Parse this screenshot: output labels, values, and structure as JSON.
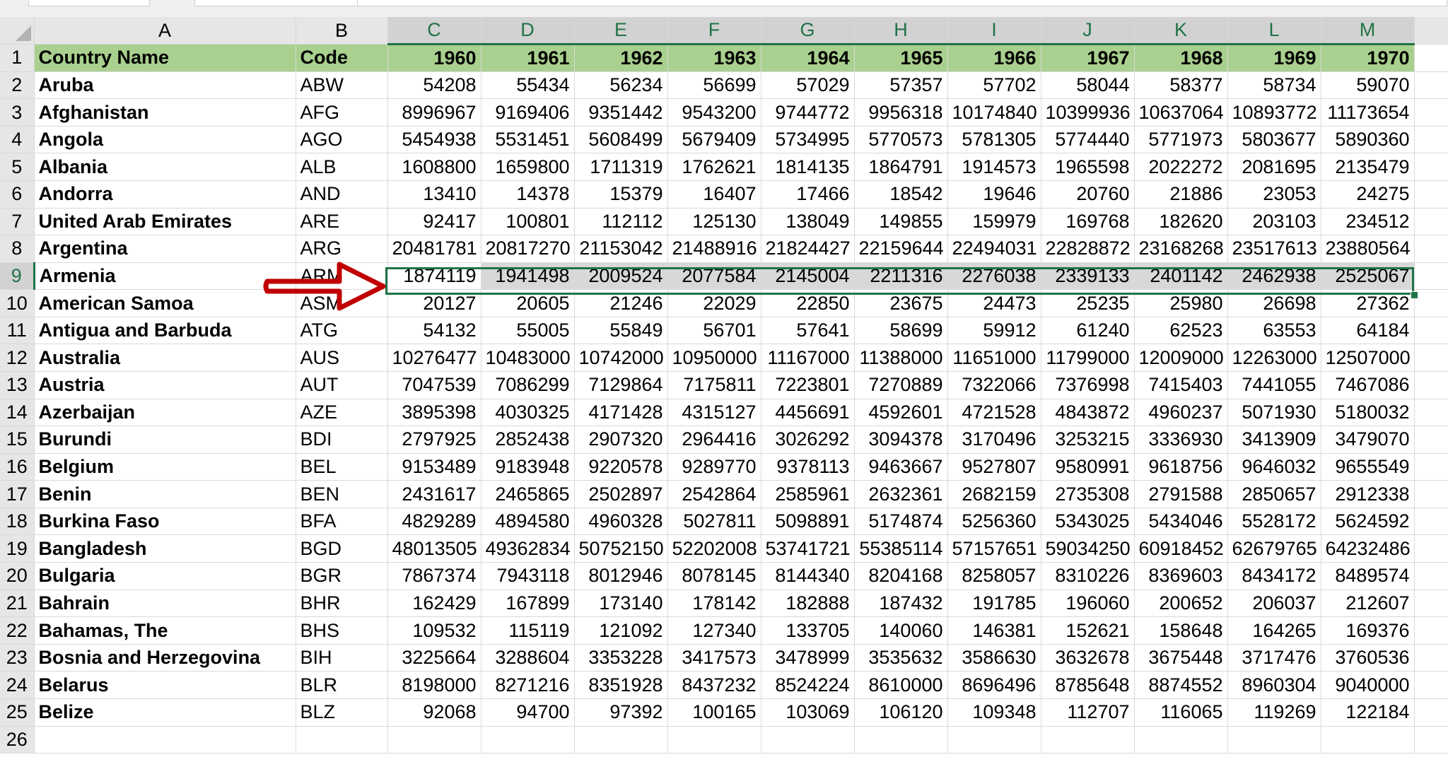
{
  "sheet": {
    "columns": [
      "A",
      "B",
      "C",
      "D",
      "E",
      "F",
      "G",
      "H",
      "I",
      "J",
      "K",
      "L",
      "M"
    ],
    "header": [
      "Country Name",
      "Code",
      "1960",
      "1961",
      "1962",
      "1963",
      "1964",
      "1965",
      "1966",
      "1967",
      "1968",
      "1969",
      "1970"
    ],
    "rows": [
      [
        "Aruba",
        "ABW",
        "54208",
        "55434",
        "56234",
        "56699",
        "57029",
        "57357",
        "57702",
        "58044",
        "58377",
        "58734",
        "59070"
      ],
      [
        "Afghanistan",
        "AFG",
        "8996967",
        "9169406",
        "9351442",
        "9543200",
        "9744772",
        "9956318",
        "10174840",
        "10399936",
        "10637064",
        "10893772",
        "11173654"
      ],
      [
        "Angola",
        "AGO",
        "5454938",
        "5531451",
        "5608499",
        "5679409",
        "5734995",
        "5770573",
        "5781305",
        "5774440",
        "5771973",
        "5803677",
        "5890360"
      ],
      [
        "Albania",
        "ALB",
        "1608800",
        "1659800",
        "1711319",
        "1762621",
        "1814135",
        "1864791",
        "1914573",
        "1965598",
        "2022272",
        "2081695",
        "2135479"
      ],
      [
        "Andorra",
        "AND",
        "13410",
        "14378",
        "15379",
        "16407",
        "17466",
        "18542",
        "19646",
        "20760",
        "21886",
        "23053",
        "24275"
      ],
      [
        "United Arab Emirates",
        "ARE",
        "92417",
        "100801",
        "112112",
        "125130",
        "138049",
        "149855",
        "159979",
        "169768",
        "182620",
        "203103",
        "234512"
      ],
      [
        "Argentina",
        "ARG",
        "20481781",
        "20817270",
        "21153042",
        "21488916",
        "21824427",
        "22159644",
        "22494031",
        "22828872",
        "23168268",
        "23517613",
        "23880564"
      ],
      [
        "Armenia",
        "ARM",
        "1874119",
        "1941498",
        "2009524",
        "2077584",
        "2145004",
        "2211316",
        "2276038",
        "2339133",
        "2401142",
        "2462938",
        "2525067"
      ],
      [
        "American Samoa",
        "ASM",
        "20127",
        "20605",
        "21246",
        "22029",
        "22850",
        "23675",
        "24473",
        "25235",
        "25980",
        "26698",
        "27362"
      ],
      [
        "Antigua and Barbuda",
        "ATG",
        "54132",
        "55005",
        "55849",
        "56701",
        "57641",
        "58699",
        "59912",
        "61240",
        "62523",
        "63553",
        "64184"
      ],
      [
        "Australia",
        "AUS",
        "10276477",
        "10483000",
        "10742000",
        "10950000",
        "11167000",
        "11388000",
        "11651000",
        "11799000",
        "12009000",
        "12263000",
        "12507000"
      ],
      [
        "Austria",
        "AUT",
        "7047539",
        "7086299",
        "7129864",
        "7175811",
        "7223801",
        "7270889",
        "7322066",
        "7376998",
        "7415403",
        "7441055",
        "7467086"
      ],
      [
        "Azerbaijan",
        "AZE",
        "3895398",
        "4030325",
        "4171428",
        "4315127",
        "4456691",
        "4592601",
        "4721528",
        "4843872",
        "4960237",
        "5071930",
        "5180032"
      ],
      [
        "Burundi",
        "BDI",
        "2797925",
        "2852438",
        "2907320",
        "2964416",
        "3026292",
        "3094378",
        "3170496",
        "3253215",
        "3336930",
        "3413909",
        "3479070"
      ],
      [
        "Belgium",
        "BEL",
        "9153489",
        "9183948",
        "9220578",
        "9289770",
        "9378113",
        "9463667",
        "9527807",
        "9580991",
        "9618756",
        "9646032",
        "9655549"
      ],
      [
        "Benin",
        "BEN",
        "2431617",
        "2465865",
        "2502897",
        "2542864",
        "2585961",
        "2632361",
        "2682159",
        "2735308",
        "2791588",
        "2850657",
        "2912338"
      ],
      [
        "Burkina Faso",
        "BFA",
        "4829289",
        "4894580",
        "4960328",
        "5027811",
        "5098891",
        "5174874",
        "5256360",
        "5343025",
        "5434046",
        "5528172",
        "5624592"
      ],
      [
        "Bangladesh",
        "BGD",
        "48013505",
        "49362834",
        "50752150",
        "52202008",
        "53741721",
        "55385114",
        "57157651",
        "59034250",
        "60918452",
        "62679765",
        "64232486"
      ],
      [
        "Bulgaria",
        "BGR",
        "7867374",
        "7943118",
        "8012946",
        "8078145",
        "8144340",
        "8204168",
        "8258057",
        "8310226",
        "8369603",
        "8434172",
        "8489574"
      ],
      [
        "Bahrain",
        "BHR",
        "162429",
        "167899",
        "173140",
        "178142",
        "182888",
        "187432",
        "191785",
        "196060",
        "200652",
        "206037",
        "212607"
      ],
      [
        "Bahamas, The",
        "BHS",
        "109532",
        "115119",
        "121092",
        "127340",
        "133705",
        "140060",
        "146381",
        "152621",
        "158648",
        "164265",
        "169376"
      ],
      [
        "Bosnia and Herzegovina",
        "BIH",
        "3225664",
        "3288604",
        "3353228",
        "3417573",
        "3478999",
        "3535632",
        "3586630",
        "3632678",
        "3675448",
        "3717476",
        "3760536"
      ],
      [
        "Belarus",
        "BLR",
        "8198000",
        "8271216",
        "8351928",
        "8437232",
        "8524224",
        "8610000",
        "8696496",
        "8785648",
        "8874552",
        "8960304",
        "9040000"
      ],
      [
        "Belize",
        "BLZ",
        "92068",
        "94700",
        "97392",
        "100165",
        "103069",
        "106120",
        "109348",
        "112707",
        "116065",
        "119269",
        "122184"
      ]
    ],
    "next_row_number": "26",
    "selected_row_number": "9",
    "selected_range": "C9:M9",
    "active_cell": "C9",
    "colors": {
      "header_fill": "#a9d08e",
      "selection_border": "#217346",
      "selection_fill": "#d8d8d8",
      "arrow": "#c00000"
    }
  },
  "annotation": {
    "arrow_icon": "red-outline-arrow-right"
  }
}
